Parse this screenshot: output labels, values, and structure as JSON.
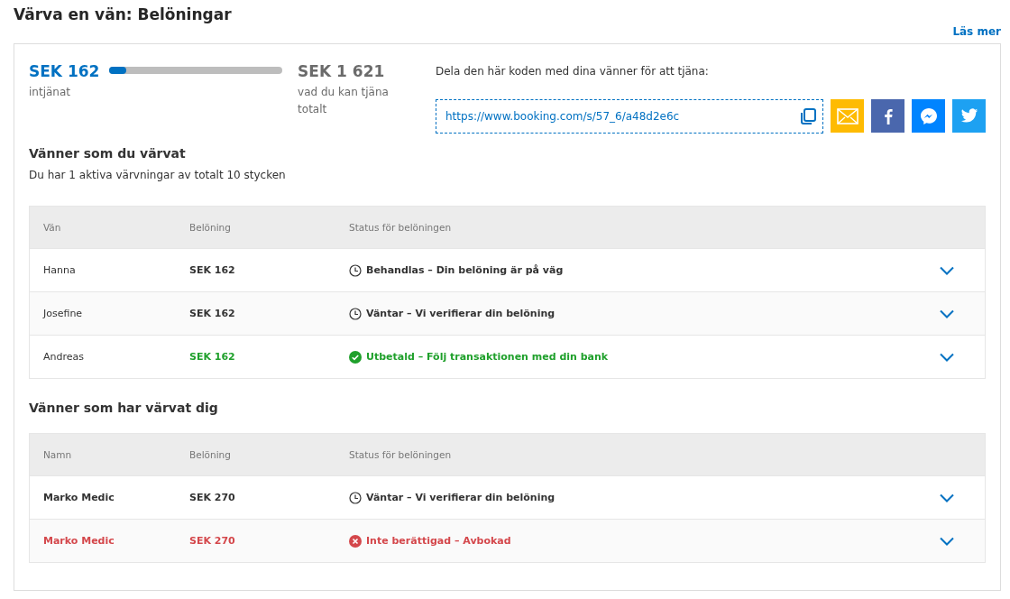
{
  "title": "Värva en vän: Belöningar",
  "read_more": "Läs mer",
  "earned": {
    "amount": "SEK 162",
    "label": "intjänat",
    "level": 0.1
  },
  "total": {
    "amount": "SEK 1 621",
    "label": "vad du kan tjäna totalt"
  },
  "share": {
    "prompt": "Dela den här koden med dina vänner för att tjäna:",
    "link": "https://www.booking.com/s/57_6/a48d2e6c",
    "buttons": [
      {
        "kind": "email"
      },
      {
        "kind": "facebook"
      },
      {
        "kind": "messenger"
      },
      {
        "kind": "twitter"
      }
    ]
  },
  "referred": {
    "heading": "Vänner som du värvat",
    "subtitle": "Du har 1 aktiva värvningar av totalt 10 stycken",
    "columns": [
      "Vän",
      "Belöning",
      "Status för belöningen"
    ],
    "rows": [
      {
        "name": "Hanna",
        "reward": "SEK 162",
        "status": "Behandlas – Din belöning är på väg",
        "kind": "pending"
      },
      {
        "name": "Josefine",
        "reward": "SEK 162",
        "status": "Väntar – Vi verifierar din belöning",
        "kind": "pending"
      },
      {
        "name": "Andreas",
        "reward": "SEK 162",
        "status": "Utbetald – Följ transaktionen med din bank",
        "kind": "paid"
      }
    ]
  },
  "referrers": {
    "heading": "Vänner som har värvat dig",
    "columns": [
      "Namn",
      "Belöning",
      "Status för belöningen"
    ],
    "rows": [
      {
        "name": "Marko Medic",
        "reward": "SEK 270",
        "status": "Väntar – Vi verifierar din belöning",
        "kind": "pending"
      },
      {
        "name": "Marko Medic",
        "reward": "SEK 270",
        "status": "Inte berättigad – Avbokad",
        "kind": "cancelled"
      }
    ]
  }
}
